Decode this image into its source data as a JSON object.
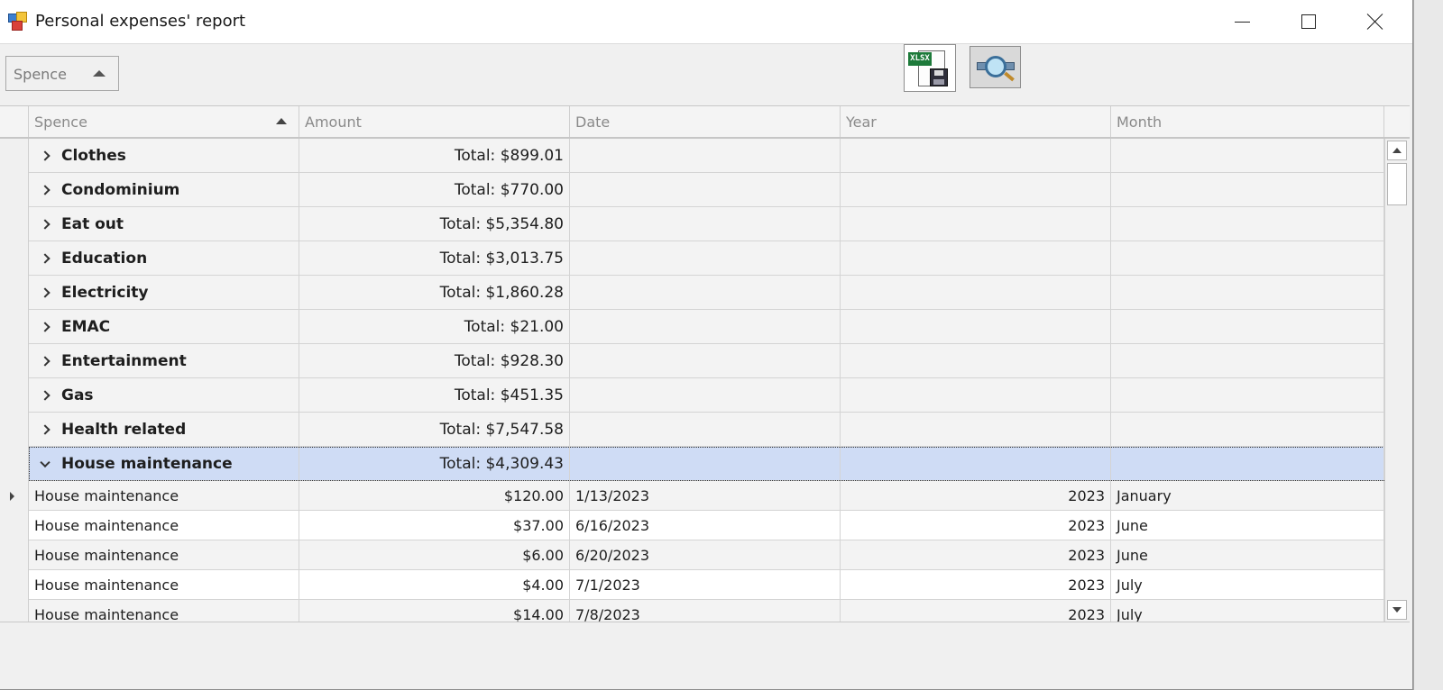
{
  "window": {
    "title": "Personal expenses' report",
    "icon": "report-app-icon",
    "controls": [
      "minimize-icon",
      "maximize-icon",
      "close-icon"
    ]
  },
  "toolbar": {
    "group_dropdown_label": "Spence",
    "export_button": {
      "icon": "xlsx-save-icon",
      "badge": "XLSX"
    },
    "preview_button": {
      "icon": "print-preview-magnifier-icon"
    }
  },
  "grid": {
    "columns": [
      "Spence",
      "Amount",
      "Date",
      "Year",
      "Month"
    ],
    "sort": {
      "column": "Spence",
      "direction": "ascending"
    },
    "groups": [
      {
        "name": "Clothes",
        "total": "Total: $899.01",
        "expanded": false
      },
      {
        "name": "Condominium",
        "total": "Total: $770.00",
        "expanded": false
      },
      {
        "name": "Eat out",
        "total": "Total: $5,354.80",
        "expanded": false
      },
      {
        "name": "Education",
        "total": "Total: $3,013.75",
        "expanded": false
      },
      {
        "name": "Electricity",
        "total": "Total: $1,860.28",
        "expanded": false
      },
      {
        "name": "EMAC",
        "total": "Total: $21.00",
        "expanded": false
      },
      {
        "name": "Entertainment",
        "total": "Total: $928.30",
        "expanded": false
      },
      {
        "name": "Gas",
        "total": "Total: $451.35",
        "expanded": false
      },
      {
        "name": "Health related",
        "total": "Total: $7,547.58",
        "expanded": false
      },
      {
        "name": "House maintenance",
        "total": "Total: $4,309.43",
        "expanded": true,
        "selected": true
      }
    ],
    "rows": [
      {
        "spence": "House maintenance",
        "amount": "$120.00",
        "date": "1/13/2023",
        "year": "2023",
        "month": "January"
      },
      {
        "spence": "House maintenance",
        "amount": "$37.00",
        "date": "6/16/2023",
        "year": "2023",
        "month": "June"
      },
      {
        "spence": "House maintenance",
        "amount": "$6.00",
        "date": "6/20/2023",
        "year": "2023",
        "month": "June"
      },
      {
        "spence": "House maintenance",
        "amount": "$4.00",
        "date": "7/1/2023",
        "year": "2023",
        "month": "July"
      },
      {
        "spence": "House maintenance",
        "amount": "$14.00",
        "date": "7/8/2023",
        "year": "2023",
        "month": "July"
      }
    ]
  },
  "colors": {
    "selected_row": "#cfdcf5",
    "group_row": "#f3f3f3",
    "window_background": "#f0f0f0"
  }
}
